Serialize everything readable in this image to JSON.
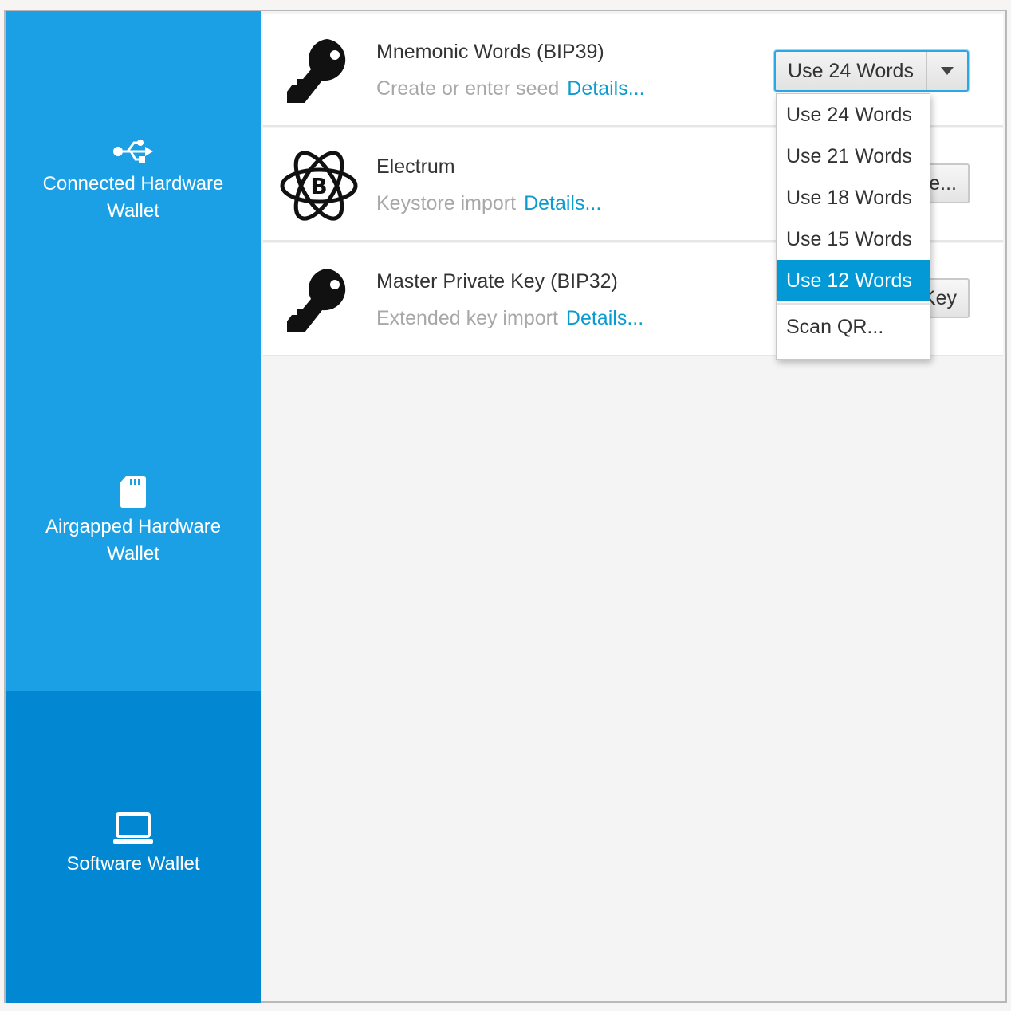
{
  "sidebar": {
    "items": [
      {
        "label": "Connected Hardware Wallet",
        "icon": "usb-icon",
        "selected": false
      },
      {
        "label": "Airgapped Hardware Wallet",
        "icon": "sd-card-icon",
        "selected": false
      },
      {
        "label": "Software Wallet",
        "icon": "laptop-icon",
        "selected": true
      }
    ]
  },
  "rows": [
    {
      "title": "Mnemonic Words (BIP39)",
      "subtitle": "Create or enter seed",
      "link": "Details...",
      "icon": "key-icon"
    },
    {
      "title": "Electrum",
      "subtitle": "Keystore import",
      "link": "Details...",
      "icon": "electrum-bitcoin-atom-icon",
      "button_visible": "e..."
    },
    {
      "title": "Master Private Key (BIP32)",
      "subtitle": "Extended key import",
      "link": "Details...",
      "icon": "key-icon",
      "button_visible": "Key"
    }
  ],
  "split_button": {
    "label": "Use 24 Words"
  },
  "dropdown": {
    "items": [
      "Use 24 Words",
      "Use 21 Words",
      "Use 18 Words",
      "Use 15 Words",
      "Use 12 Words"
    ],
    "highlighted": "Use 12 Words",
    "extra": "Scan QR..."
  },
  "colors": {
    "sidebar": "#1ba0e5",
    "sidebar_selected": "#0288d2",
    "link": "#0a9bd0",
    "highlight": "#0299d6"
  }
}
